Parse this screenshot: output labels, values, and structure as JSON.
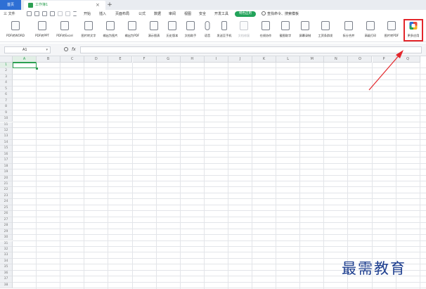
{
  "tabs": {
    "home_label": "首页",
    "doc_title": "工作簿1",
    "close_glyph": "×",
    "add_glyph": "+"
  },
  "menu": {
    "file_label": "三 文件",
    "items": [
      "开始",
      "插入",
      "页面布局",
      "公式",
      "数据",
      "审阅",
      "视图",
      "安全",
      "开发工具"
    ],
    "special_label": "特色应用",
    "search_label": "查找命令、搜索模板"
  },
  "ribbon": {
    "buttons": [
      "PDF转WORD",
      "PDF转PPT",
      "PDF转Excel",
      "图片转文字",
      "输出为图片",
      "输出为PDF",
      "演示图表",
      "历史版本",
      "文档助手",
      "语音",
      "发送至手机",
      "文档修复",
      "在线协作",
      "截图取字",
      "屏幕录制",
      "工资条群发",
      "拆分合并",
      "高级打印",
      "图片转PDF",
      "更多应用"
    ]
  },
  "formula_bar": {
    "cell_ref": "A1",
    "dropdown_glyph": "▾",
    "fx_label": "fx",
    "value": ""
  },
  "grid": {
    "columns": [
      "A",
      "B",
      "C",
      "D",
      "E",
      "F",
      "G",
      "H",
      "I",
      "J",
      "K",
      "L",
      "M",
      "N",
      "O",
      "P",
      "Q"
    ],
    "rows": [
      "1",
      "2",
      "3",
      "4",
      "5",
      "6",
      "7",
      "8",
      "9",
      "10",
      "11",
      "12",
      "13",
      "14",
      "15",
      "16",
      "17",
      "18",
      "19",
      "20",
      "21",
      "22",
      "23",
      "24",
      "25",
      "26",
      "27",
      "28",
      "29",
      "30",
      "31",
      "32",
      "33",
      "34",
      "35",
      "36",
      "37",
      "38"
    ],
    "active_cell": "A1"
  },
  "annotation": {
    "highlight_color": "#e3262b",
    "arrow_color": "#e3262b"
  },
  "watermark_text": "最需教育"
}
